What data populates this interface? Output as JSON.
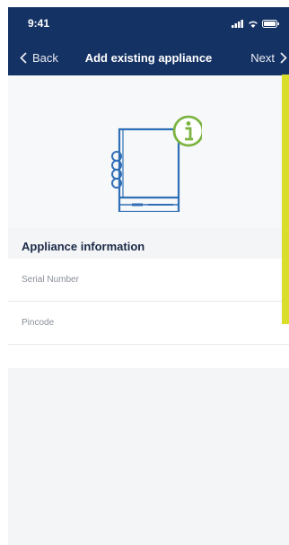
{
  "status_bar": {
    "time": "9:41",
    "icons": [
      "signal-icon",
      "wifi-icon",
      "battery-icon"
    ]
  },
  "nav": {
    "back_label": "Back",
    "title": "Add existing appliance",
    "next_label": "Next"
  },
  "section": {
    "title": "Appliance information"
  },
  "fields": [
    {
      "name": "serial-number",
      "placeholder": "Serial Number",
      "value": ""
    },
    {
      "name": "pincode",
      "placeholder": "Pincode",
      "value": ""
    }
  ],
  "colors": {
    "nav_bg": "#153265",
    "icon_blue": "#2f6fb5",
    "info_green": "#7cb342",
    "highlight": "#d9de2b"
  }
}
